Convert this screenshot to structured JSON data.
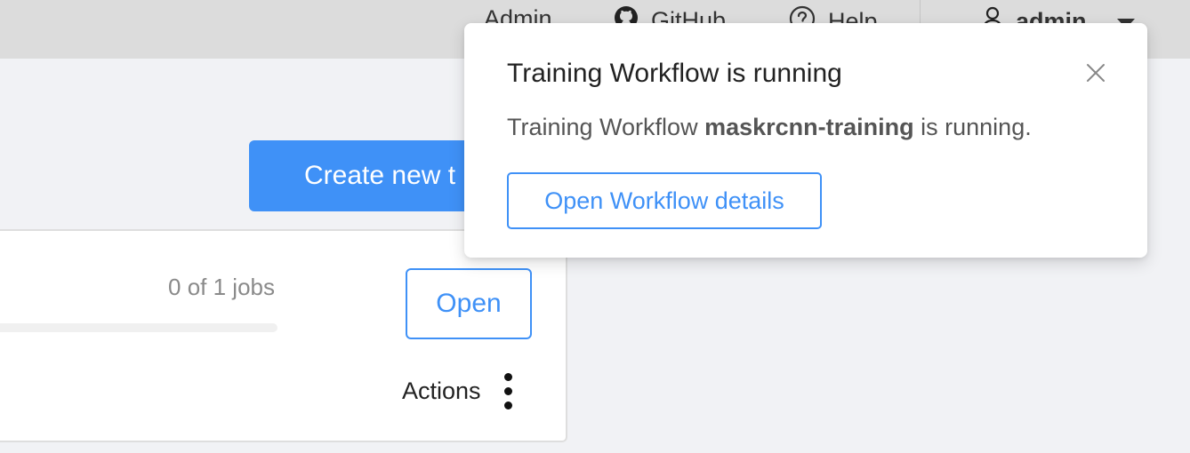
{
  "header": {
    "admin_link": "Admin",
    "github_link": "GitHub",
    "help_link": "Help",
    "username": "admin"
  },
  "main": {
    "create_button": "Create new t"
  },
  "task_card": {
    "jobs_status": "0 of 1 jobs",
    "progress_fraction": 0,
    "open_button": "Open",
    "actions_label": "Actions"
  },
  "notification": {
    "title": "Training Workflow is running",
    "message_prefix": "Training Workflow ",
    "workflow_name": "maskrcnn-training",
    "message_suffix": " is running.",
    "details_button": "Open Workflow details"
  },
  "colors": {
    "accent": "#3f91f7",
    "header_bg": "#dcdcdc",
    "page_bg": "#f1f2f5"
  },
  "icons": [
    "github-icon",
    "help-icon",
    "user-icon",
    "dropdown-caret-icon",
    "close-icon",
    "kebab-menu-icon"
  ]
}
